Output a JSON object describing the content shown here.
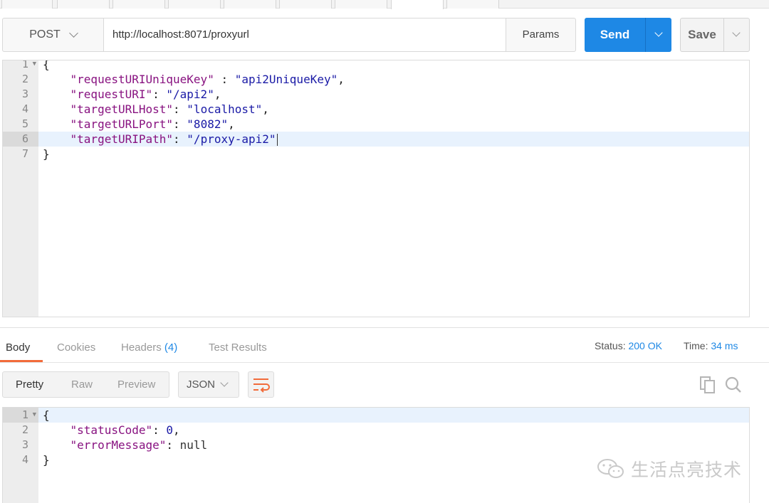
{
  "request": {
    "method": "POST",
    "url": "http://localhost:8071/proxyurl",
    "params_label": "Params",
    "send_label": "Send",
    "save_label": "Save"
  },
  "request_body": {
    "lines": [
      {
        "num": "1",
        "text": "{"
      },
      {
        "num": "2",
        "key": "\"requestURIUniqueKey\"",
        "sep": " : ",
        "value": "\"api2UniqueKey\"",
        "end": ","
      },
      {
        "num": "3",
        "key": "\"requestURI\"",
        "sep": ": ",
        "value": "\"/api2\"",
        "end": ","
      },
      {
        "num": "4",
        "key": "\"targetURLHost\"",
        "sep": ": ",
        "value": "\"localhost\"",
        "end": ","
      },
      {
        "num": "5",
        "key": "\"targetURLPort\"",
        "sep": ": ",
        "value": "\"8082\"",
        "end": ","
      },
      {
        "num": "6",
        "key": "\"targetURIPath\"",
        "sep": ": ",
        "value": "\"/proxy-api2\"",
        "end": ""
      },
      {
        "num": "7",
        "text": "}"
      }
    ]
  },
  "response": {
    "tabs": {
      "body": "Body",
      "cookies": "Cookies",
      "headers": "Headers",
      "headers_count": "(4)",
      "test_results": "Test Results"
    },
    "status_label": "Status:",
    "status_value": "200 OK",
    "time_label": "Time:",
    "time_value": "34 ms",
    "view_modes": {
      "pretty": "Pretty",
      "raw": "Raw",
      "preview": "Preview"
    },
    "format": "JSON",
    "lines": [
      {
        "num": "1",
        "text": "{"
      },
      {
        "num": "2",
        "key": "\"statusCode\"",
        "sep": ": ",
        "value": "0",
        "end": ","
      },
      {
        "num": "3",
        "key": "\"errorMessage\"",
        "sep": ": ",
        "value": "null",
        "end": ""
      },
      {
        "num": "4",
        "text": "}"
      }
    ]
  },
  "watermark": "生活点亮技术",
  "colors": {
    "accent": "#1e88e5",
    "tab_underline": "#f26b3a",
    "json_key": "#881280",
    "json_string": "#1a1aa6"
  }
}
